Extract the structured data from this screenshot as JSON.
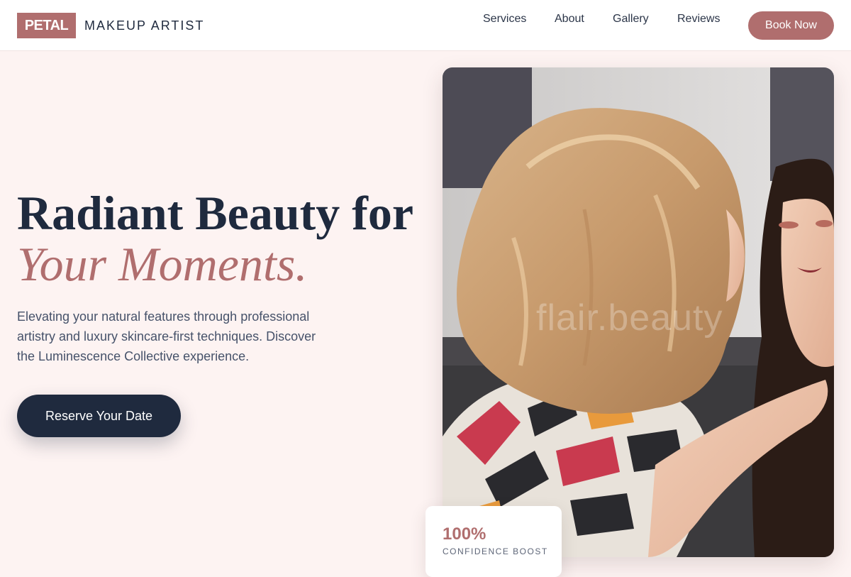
{
  "brand": {
    "logo_text": "PETAL",
    "tagline": "MAKEUP ARTIST",
    "accent_color": "#b06e6e",
    "dark_color": "#1f2a3e"
  },
  "nav": {
    "items": [
      {
        "label": "Services"
      },
      {
        "label": "About"
      },
      {
        "label": "Gallery"
      },
      {
        "label": "Reviews"
      }
    ],
    "cta_label": "Book Now"
  },
  "hero": {
    "title_line1": "Radiant Beauty for",
    "title_line2": "Your Moments.",
    "description": "Elevating your natural features through professional artistry and luxury skincare-first techniques. Discover the Luminescence Collective experience.",
    "cta_label": "Reserve Your Date"
  },
  "photo": {
    "subject": "makeup-artist-at-work-photo",
    "watermark": "flair.beauty"
  },
  "stat": {
    "value": "100%",
    "label": "CONFIDENCE BOOST"
  }
}
